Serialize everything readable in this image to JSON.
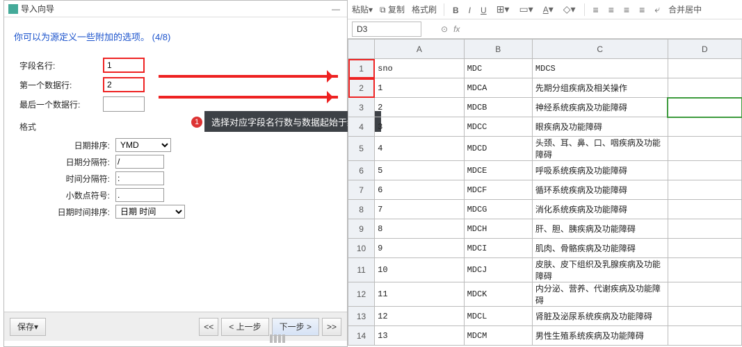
{
  "dialog": {
    "title": "导入向导",
    "heading": "你可以为源定义一些附加的选项。 (4/8)",
    "fields": {
      "fieldRowLabel": "字段名行:",
      "fieldRowVal": "1",
      "firstDataLabel": "第一个数据行:",
      "firstDataVal": "2",
      "lastDataLabel": "最后一个数据行:",
      "lastDataVal": ""
    },
    "fmt": {
      "legend": "格式",
      "dateOrderLabel": "日期排序:",
      "dateOrder": "YMD",
      "dateSepLabel": "日期分隔符:",
      "dateSep": "/",
      "timeSepLabel": "时间分隔符:",
      "timeSep": ":",
      "decLabel": "小数点符号:",
      "dec": ".",
      "dtOrderLabel": "日期时间排序:",
      "dtOrder": "日期 时间"
    },
    "buttons": {
      "save": "保存",
      "first": "<<",
      "prev": "< 上一步",
      "next": "下一步 >",
      "last": ">>"
    }
  },
  "callout": {
    "num": "1",
    "text": "选择对应字段名行数与数据起始于结束行"
  },
  "toolbar": {
    "paste": "粘贴",
    "copy": "复制",
    "fmtpaint": "格式刷",
    "merge": "合并居中"
  },
  "namebox": "D3",
  "sheet": {
    "cols": [
      "A",
      "B",
      "C",
      "D"
    ],
    "rows": [
      {
        "n": "1",
        "a": "sno",
        "b": "MDC",
        "c": "MDCS",
        "d": ""
      },
      {
        "n": "2",
        "a": "1",
        "b": "MDCA",
        "c": "先期分组疾病及相关操作",
        "d": ""
      },
      {
        "n": "3",
        "a": "2",
        "b": "MDCB",
        "c": "神经系统疾病及功能障碍",
        "d": ""
      },
      {
        "n": "4",
        "a": "3",
        "b": "MDCC",
        "c": "眼疾病及功能障碍",
        "d": ""
      },
      {
        "n": "5",
        "a": "4",
        "b": "MDCD",
        "c": "头颈、耳、鼻、口、咽疾病及功能障碍",
        "d": ""
      },
      {
        "n": "6",
        "a": "5",
        "b": "MDCE",
        "c": "呼吸系统疾病及功能障碍",
        "d": ""
      },
      {
        "n": "7",
        "a": "6",
        "b": "MDCF",
        "c": "循环系统疾病及功能障碍",
        "d": ""
      },
      {
        "n": "8",
        "a": "7",
        "b": "MDCG",
        "c": "消化系统疾病及功能障碍",
        "d": ""
      },
      {
        "n": "9",
        "a": "8",
        "b": "MDCH",
        "c": "肝、胆、胰疾病及功能障碍",
        "d": ""
      },
      {
        "n": "10",
        "a": "9",
        "b": "MDCI",
        "c": "肌肉、骨骼疾病及功能障碍",
        "d": ""
      },
      {
        "n": "11",
        "a": "10",
        "b": "MDCJ",
        "c": "皮肤、皮下组织及乳腺疾病及功能障碍",
        "d": ""
      },
      {
        "n": "12",
        "a": "11",
        "b": "MDCK",
        "c": "内分泌、营养、代谢疾病及功能障碍",
        "d": ""
      },
      {
        "n": "13",
        "a": "12",
        "b": "MDCL",
        "c": "肾脏及泌尿系统疾病及功能障碍",
        "d": ""
      },
      {
        "n": "14",
        "a": "13",
        "b": "MDCM",
        "c": "男性生殖系统疾病及功能障碍",
        "d": ""
      }
    ]
  },
  "watermark": ""
}
